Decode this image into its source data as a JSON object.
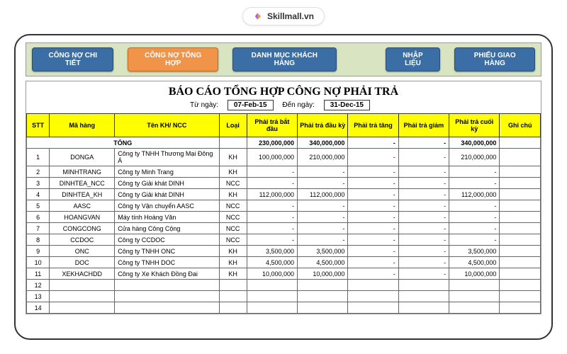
{
  "brand": {
    "label": "Skillmall.vn"
  },
  "nav": {
    "items": [
      {
        "label": "CÔNG NỢ CHI TIẾT",
        "active": false
      },
      {
        "label": "CÔNG NỢ TỔNG HỢP",
        "active": true
      },
      {
        "label": "DANH MỤC KHÁCH HÀNG",
        "active": false
      },
      {
        "label": "NHẬP LIỆU",
        "active": false
      },
      {
        "label": "PHIẾU GIAO HÀNG",
        "active": false
      }
    ]
  },
  "report": {
    "title": "BÁO CÁO TỔNG HỢP CÔNG NỢ PHẢI TRẢ",
    "from_label": "Từ ngày:",
    "from_date": "07-Feb-15",
    "to_label": "Đến ngày:",
    "to_date": "31-Dec-15"
  },
  "columns": {
    "stt": "STT",
    "ma": "Mã hàng",
    "ten": "Tên KH/ NCC",
    "loai": "Loại",
    "batdau": "Phải trả bắt đầu",
    "dauky": "Phải trả đầu kỳ",
    "tang": "Phải trả tăng",
    "giam": "Phải trả giảm",
    "cuoiky": "Phải trả cuối kỳ",
    "ghichu": "Ghi chú"
  },
  "total": {
    "label": "TỔNG",
    "batdau": "230,000,000",
    "dauky": "340,000,000",
    "tang": "-",
    "giam": "-",
    "cuoiky": "340,000,000"
  },
  "rows": [
    {
      "stt": "1",
      "ma": "DONGA",
      "ten": "Công ty TNHH Thương Mại Đông Á",
      "loai": "KH",
      "batdau": "100,000,000",
      "dauky": "210,000,000",
      "tang": "-",
      "giam": "-",
      "cuoiky": "210,000,000"
    },
    {
      "stt": "2",
      "ma": "MINHTRANG",
      "ten": "Công ty Minh Trang",
      "loai": "KH",
      "batdau": "-",
      "dauky": "-",
      "tang": "-",
      "giam": "-",
      "cuoiky": "-"
    },
    {
      "stt": "3",
      "ma": "DINHTEA_NCC",
      "ten": "Công ty Giải khát DINH",
      "loai": "NCC",
      "batdau": "-",
      "dauky": "-",
      "tang": "-",
      "giam": "-",
      "cuoiky": "-"
    },
    {
      "stt": "4",
      "ma": "DINHTEA_KH",
      "ten": "Công ty Giải khát DINH",
      "loai": "KH",
      "batdau": "112,000,000",
      "dauky": "112,000,000",
      "tang": "-",
      "giam": "-",
      "cuoiky": "112,000,000"
    },
    {
      "stt": "5",
      "ma": "AASC",
      "ten": "Công ty Vận chuyển AASC",
      "loai": "NCC",
      "batdau": "-",
      "dauky": "-",
      "tang": "-",
      "giam": "-",
      "cuoiky": "-"
    },
    {
      "stt": "6",
      "ma": "HOANGVAN",
      "ten": "Máy tính Hoàng Văn",
      "loai": "NCC",
      "batdau": "-",
      "dauky": "-",
      "tang": "-",
      "giam": "-",
      "cuoiky": "-"
    },
    {
      "stt": "7",
      "ma": "CONGCONG",
      "ten": "Cửa hàng Công Cộng",
      "loai": "NCC",
      "batdau": "-",
      "dauky": "-",
      "tang": "-",
      "giam": "-",
      "cuoiky": "-"
    },
    {
      "stt": "8",
      "ma": "CCDOC",
      "ten": "Công ty CCDOC",
      "loai": "NCC",
      "batdau": "-",
      "dauky": "-",
      "tang": "-",
      "giam": "-",
      "cuoiky": "-"
    },
    {
      "stt": "9",
      "ma": "ONC",
      "ten": "Công ty TNHH ONC",
      "loai": "KH",
      "batdau": "3,500,000",
      "dauky": "3,500,000",
      "tang": "-",
      "giam": "-",
      "cuoiky": "3,500,000"
    },
    {
      "stt": "10",
      "ma": "DOC",
      "ten": "Công ty TNHH DOC",
      "loai": "KH",
      "batdau": "4,500,000",
      "dauky": "4,500,000",
      "tang": "-",
      "giam": "-",
      "cuoiky": "4,500,000"
    },
    {
      "stt": "11",
      "ma": "XEKHACHDD",
      "ten": "Công ty Xe Khách Đồng Đai",
      "loai": "KH",
      "batdau": "10,000,000",
      "dauky": "10,000,000",
      "tang": "-",
      "giam": "-",
      "cuoiky": "10,000,000"
    },
    {
      "stt": "12",
      "ma": "",
      "ten": "",
      "loai": "",
      "batdau": "",
      "dauky": "",
      "tang": "",
      "giam": "",
      "cuoiky": ""
    },
    {
      "stt": "13",
      "ma": "",
      "ten": "",
      "loai": "",
      "batdau": "",
      "dauky": "",
      "tang": "",
      "giam": "",
      "cuoiky": ""
    },
    {
      "stt": "14",
      "ma": "",
      "ten": "",
      "loai": "",
      "batdau": "",
      "dauky": "",
      "tang": "",
      "giam": "",
      "cuoiky": ""
    }
  ]
}
